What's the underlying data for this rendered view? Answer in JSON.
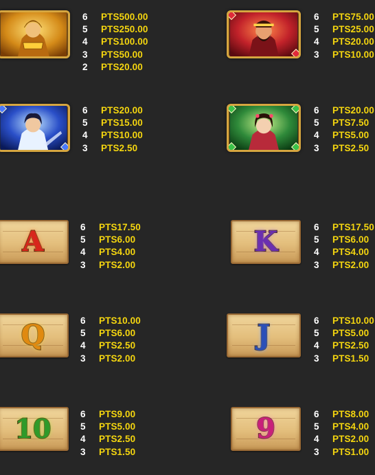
{
  "symbols": [
    {
      "id": "warrior-gold",
      "kind": "character",
      "colors": {
        "bg": "#c98a1c",
        "accent": "#ffd54a"
      },
      "payouts": [
        {
          "count": "6",
          "pts": "PTS500.00"
        },
        {
          "count": "5",
          "pts": "PTS250.00"
        },
        {
          "count": "4",
          "pts": "PTS100.00"
        },
        {
          "count": "3",
          "pts": "PTS50.00"
        },
        {
          "count": "2",
          "pts": "PTS20.00"
        }
      ]
    },
    {
      "id": "warrior-red",
      "kind": "character",
      "colors": {
        "bg": "#c2222a",
        "accent": "#ff6a3a"
      },
      "payouts": [
        {
          "count": "6",
          "pts": "PTS75.00"
        },
        {
          "count": "5",
          "pts": "PTS25.00"
        },
        {
          "count": "4",
          "pts": "PTS20.00"
        },
        {
          "count": "3",
          "pts": "PTS10.00"
        }
      ]
    },
    {
      "id": "scholar-blue",
      "kind": "character",
      "colors": {
        "bg": "#2a4fc8",
        "accent": "#9fd1ff"
      },
      "payouts": [
        {
          "count": "6",
          "pts": "PTS20.00"
        },
        {
          "count": "5",
          "pts": "PTS15.00"
        },
        {
          "count": "4",
          "pts": "PTS10.00"
        },
        {
          "count": "3",
          "pts": "PTS2.50"
        }
      ]
    },
    {
      "id": "maiden-green",
      "kind": "character",
      "colors": {
        "bg": "#2f8a3a",
        "accent": "#a8e06a"
      },
      "payouts": [
        {
          "count": "6",
          "pts": "PTS20.00"
        },
        {
          "count": "5",
          "pts": "PTS7.50"
        },
        {
          "count": "4",
          "pts": "PTS5.00"
        },
        {
          "count": "3",
          "pts": "PTS2.50"
        }
      ]
    },
    {
      "id": "card-a",
      "kind": "card",
      "glyph": "A",
      "colors": {
        "glyph": "#d8261c",
        "glyph_light": "#ff7a3a"
      },
      "payouts": [
        {
          "count": "6",
          "pts": "PTS17.50"
        },
        {
          "count": "5",
          "pts": "PTS6.00"
        },
        {
          "count": "4",
          "pts": "PTS4.00"
        },
        {
          "count": "3",
          "pts": "PTS2.00"
        }
      ]
    },
    {
      "id": "card-k",
      "kind": "card",
      "glyph": "K",
      "colors": {
        "glyph": "#6a2fb0",
        "glyph_light": "#b07ae8"
      },
      "payouts": [
        {
          "count": "6",
          "pts": "PTS17.50"
        },
        {
          "count": "5",
          "pts": "PTS6.00"
        },
        {
          "count": "4",
          "pts": "PTS4.00"
        },
        {
          "count": "3",
          "pts": "PTS2.00"
        }
      ]
    },
    {
      "id": "card-q",
      "kind": "card",
      "glyph": "Q",
      "colors": {
        "glyph": "#e08a10",
        "glyph_light": "#ffd24a"
      },
      "payouts": [
        {
          "count": "6",
          "pts": "PTS10.00"
        },
        {
          "count": "5",
          "pts": "PTS6.00"
        },
        {
          "count": "4",
          "pts": "PTS2.50"
        },
        {
          "count": "3",
          "pts": "PTS2.00"
        }
      ]
    },
    {
      "id": "card-j",
      "kind": "card",
      "glyph": "J",
      "colors": {
        "glyph": "#2a4fb8",
        "glyph_light": "#7aa8ff"
      },
      "payouts": [
        {
          "count": "6",
          "pts": "PTS10.00"
        },
        {
          "count": "5",
          "pts": "PTS5.00"
        },
        {
          "count": "4",
          "pts": "PTS2.50"
        },
        {
          "count": "3",
          "pts": "PTS1.50"
        }
      ]
    },
    {
      "id": "card-10",
      "kind": "card",
      "glyph": "10",
      "colors": {
        "glyph": "#2f9a2a",
        "glyph_light": "#a8e04a"
      },
      "payouts": [
        {
          "count": "6",
          "pts": "PTS9.00"
        },
        {
          "count": "5",
          "pts": "PTS5.00"
        },
        {
          "count": "4",
          "pts": "PTS2.50"
        },
        {
          "count": "3",
          "pts": "PTS1.50"
        }
      ]
    },
    {
      "id": "card-9",
      "kind": "card",
      "glyph": "9",
      "colors": {
        "glyph": "#c8207a",
        "glyph_light": "#ff7ac0"
      },
      "payouts": [
        {
          "count": "6",
          "pts": "PTS8.00"
        },
        {
          "count": "5",
          "pts": "PTS4.00"
        },
        {
          "count": "4",
          "pts": "PTS2.00"
        },
        {
          "count": "3",
          "pts": "PTS1.00"
        }
      ]
    }
  ]
}
